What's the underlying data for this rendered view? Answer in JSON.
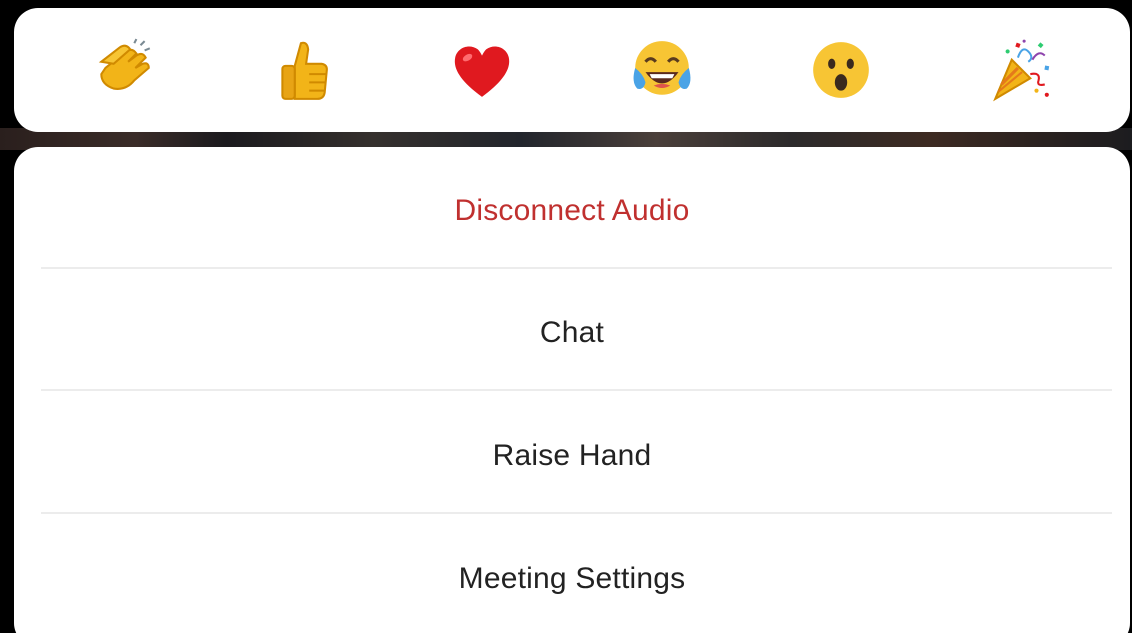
{
  "reactions": [
    {
      "name": "clapping-hands",
      "icon": "clapping-hands-icon"
    },
    {
      "name": "thumbs-up",
      "icon": "thumbs-up-icon"
    },
    {
      "name": "heart",
      "icon": "heart-icon"
    },
    {
      "name": "tears-of-joy",
      "icon": "tears-of-joy-icon"
    },
    {
      "name": "open-mouth",
      "icon": "open-mouth-face-icon"
    },
    {
      "name": "party-popper",
      "icon": "party-popper-icon"
    }
  ],
  "menu": {
    "disconnect_audio": "Disconnect Audio",
    "chat": "Chat",
    "raise_hand": "Raise Hand",
    "meeting_settings": "Meeting Settings"
  },
  "colors": {
    "danger": "#c0302f",
    "text": "#222222",
    "divider": "#ececec",
    "panel": "#ffffff",
    "backdrop": "#000000"
  }
}
